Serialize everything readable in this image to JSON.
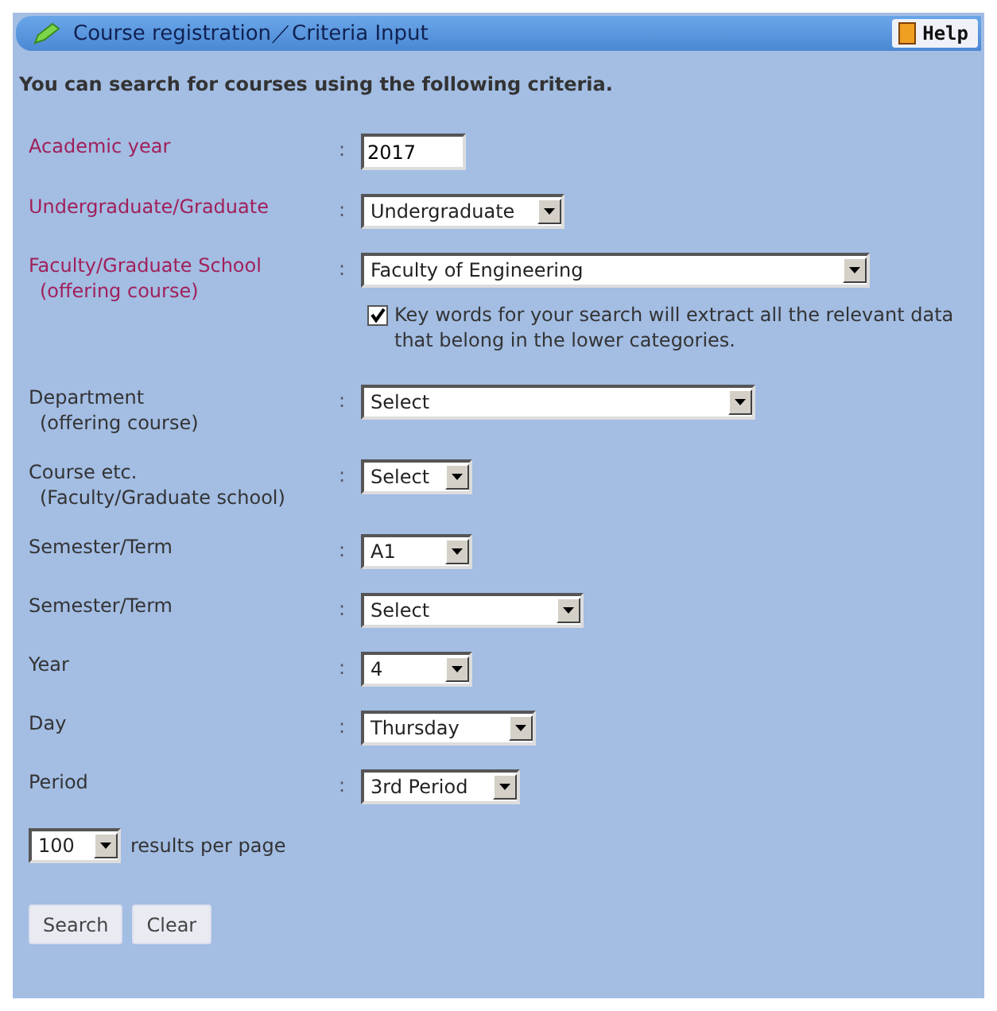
{
  "window": {
    "title": "Course registration／Criteria Input",
    "help": "Help"
  },
  "intro": "You can search for courses using the following criteria.",
  "fields": [
    {
      "label": "Academic year",
      "required": true,
      "kind": "text",
      "value": "2017"
    },
    {
      "label": "Undergraduate/Graduate",
      "required": true,
      "kind": "select",
      "value": "Undergraduate"
    },
    {
      "label": "Faculty/Graduate School",
      "sublabel": "(offering course)",
      "required": true,
      "kind": "select",
      "value": "Faculty of Engineering",
      "note": {
        "checked": true,
        "text": "Key words for your search will extract all the relevant data that belong in the lower categories."
      }
    },
    {
      "label": "Department",
      "sublabel": "(offering course)",
      "required": false,
      "kind": "select",
      "value": "Select"
    },
    {
      "label": "Course etc.",
      "sublabel": "(Faculty/Graduate school)",
      "required": false,
      "kind": "select",
      "value": "Select"
    },
    {
      "label": "Semester/Term",
      "required": false,
      "kind": "select",
      "value": "A1"
    },
    {
      "label": "Semester/Term",
      "required": false,
      "kind": "select",
      "value": "Select"
    },
    {
      "label": "Year",
      "required": false,
      "kind": "select",
      "value": "4"
    },
    {
      "label": "Day",
      "required": false,
      "kind": "select",
      "value": "Thursday"
    },
    {
      "label": "Period",
      "required": false,
      "kind": "select",
      "value": "3rd Period"
    }
  ],
  "per_page": {
    "value": "100",
    "label": "results per page"
  },
  "separator": ":",
  "buttons": [
    "Search",
    "Clear"
  ]
}
